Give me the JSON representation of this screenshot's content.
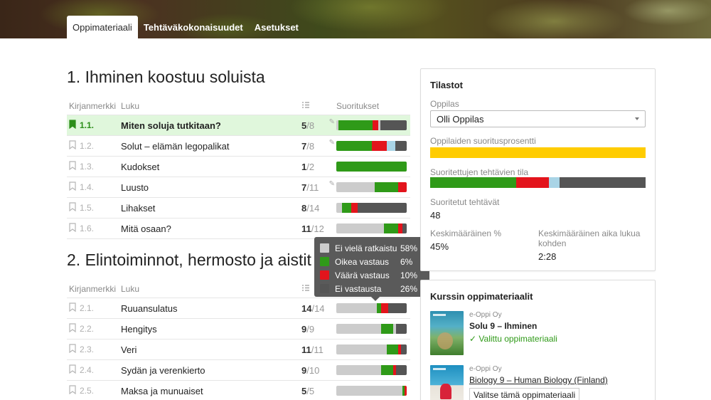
{
  "tabs": [
    "Oppimateriaali",
    "Tehtäväkokonaisuudet",
    "Asetukset"
  ],
  "sections": [
    {
      "title": "1. Ihminen koostuu soluista",
      "headers": {
        "bookmark": "Kirjanmerkki",
        "chapter": "Luku",
        "performance": "Suoritukset"
      },
      "rows": [
        {
          "num": "1.1.",
          "title": "Miten soluja tutkitaan?",
          "done": "5",
          "total": "/8",
          "edited": true,
          "selected": true,
          "bar": [
            [
              "light",
              3
            ],
            [
              "green",
              48
            ],
            [
              "red",
              8
            ],
            [
              "light",
              3
            ],
            [
              "dark",
              37
            ]
          ]
        },
        {
          "num": "1.2.",
          "title": "Solut – elämän legopalikat",
          "done": "7",
          "total": "/8",
          "edited": true,
          "bar": [
            [
              "green",
              50
            ],
            [
              "red",
              22
            ],
            [
              "blue",
              12
            ],
            [
              "dark",
              16
            ]
          ]
        },
        {
          "num": "1.3.",
          "title": "Kudokset",
          "done": "1",
          "total": "/2",
          "bar": [
            [
              "green",
              100
            ]
          ]
        },
        {
          "num": "1.4.",
          "title": "Luusto",
          "done": "7",
          "total": "/11",
          "edited": true,
          "bar": [
            [
              "light",
              55
            ],
            [
              "green",
              33
            ],
            [
              "red",
              12
            ]
          ]
        },
        {
          "num": "1.5.",
          "title": "Lihakset",
          "done": "8",
          "total": "/14",
          "bar": [
            [
              "light",
              8
            ],
            [
              "green",
              13
            ],
            [
              "red",
              9
            ],
            [
              "dark",
              70
            ]
          ]
        },
        {
          "num": "1.6.",
          "title": "Mitä osaan?",
          "done": "11",
          "total": "/12",
          "bar": [
            [
              "light",
              68
            ],
            [
              "green",
              20
            ],
            [
              "red",
              6
            ],
            [
              "dark",
              6
            ]
          ]
        }
      ]
    },
    {
      "title": "2. Elintoiminnot, hermosto ja aistit",
      "headers": {
        "bookmark": "Kirjanmerkki",
        "chapter": "Luku",
        "performance": "Suoritukset"
      },
      "rows": [
        {
          "num": "2.1.",
          "title": "Ruuansulatus",
          "done": "14",
          "total": "/14",
          "bar": [
            [
              "light",
              58
            ],
            [
              "green",
              6
            ],
            [
              "red",
              10
            ],
            [
              "dark",
              26
            ]
          ]
        },
        {
          "num": "2.2.",
          "title": "Hengitys",
          "done": "9",
          "total": "/9",
          "bar": [
            [
              "light",
              64
            ],
            [
              "green",
              17
            ],
            [
              "light",
              4
            ],
            [
              "dark",
              15
            ]
          ]
        },
        {
          "num": "2.3.",
          "title": "Veri",
          "done": "11",
          "total": "/11",
          "bar": [
            [
              "light",
              72
            ],
            [
              "green",
              16
            ],
            [
              "red",
              4
            ],
            [
              "dark",
              8
            ]
          ]
        },
        {
          "num": "2.4.",
          "title": "Sydän ja verenkierto",
          "done": "9",
          "total": "/10",
          "bar": [
            [
              "light",
              64
            ],
            [
              "green",
              17
            ],
            [
              "red",
              4
            ],
            [
              "dark",
              15
            ]
          ]
        },
        {
          "num": "2.5.",
          "title": "Maksa ja munuaiset",
          "done": "5",
          "total": "/5",
          "bar": [
            [
              "light",
              94
            ],
            [
              "green",
              3
            ],
            [
              "red",
              3
            ]
          ]
        }
      ]
    }
  ],
  "tooltip": {
    "items": [
      {
        "label": "Ei vielä ratkaistu",
        "value": "58%",
        "color": "#cccccc"
      },
      {
        "label": "Oikea vastaus",
        "value": "6%",
        "color": "#2f9a18"
      },
      {
        "label": "Väärä vastaus",
        "value": "10%",
        "color": "#e3141c"
      },
      {
        "label": "Ei vastausta",
        "value": "26%",
        "color": "#555555"
      }
    ]
  },
  "stats": {
    "title": "Tilastot",
    "student_label": "Oppilas",
    "student_value": "Olli Oppilas",
    "percent_label": "Oppilaiden suoritusprosentti",
    "percent_bar": [
      [
        "yellow",
        100
      ]
    ],
    "status_label": "Suoritettujen tehtävien tila",
    "status_bar": [
      [
        "green",
        40
      ],
      [
        "red",
        15
      ],
      [
        "blue",
        5
      ],
      [
        "dark",
        40
      ]
    ],
    "completed_label": "Suoritetut tehtävät",
    "completed_value": "48",
    "avg_label": "Keskimääräinen %",
    "avg_value": "45%",
    "avg_time_label": "Keskimääräinen aika lukua kohden",
    "avg_time_value": "2:28"
  },
  "materials": {
    "title": "Kurssin oppimateriaalit",
    "items": [
      {
        "publisher": "e-Oppi Oy",
        "title": "Solu 9 – Ihminen",
        "status": "Valittu oppimateriaali"
      },
      {
        "publisher": "e-Oppi Oy",
        "title": "Biology 9 – Human Biology (Finland)",
        "button": "Valitse tämä oppimateriaali"
      }
    ]
  },
  "colors": {
    "green": "#2f9a18",
    "red": "#e3141c",
    "light": "#cccccc",
    "blue": "#a9d4e6",
    "dark": "#555555",
    "yellow": "#ffcc00",
    "selected_row": "#e0f7dc"
  }
}
